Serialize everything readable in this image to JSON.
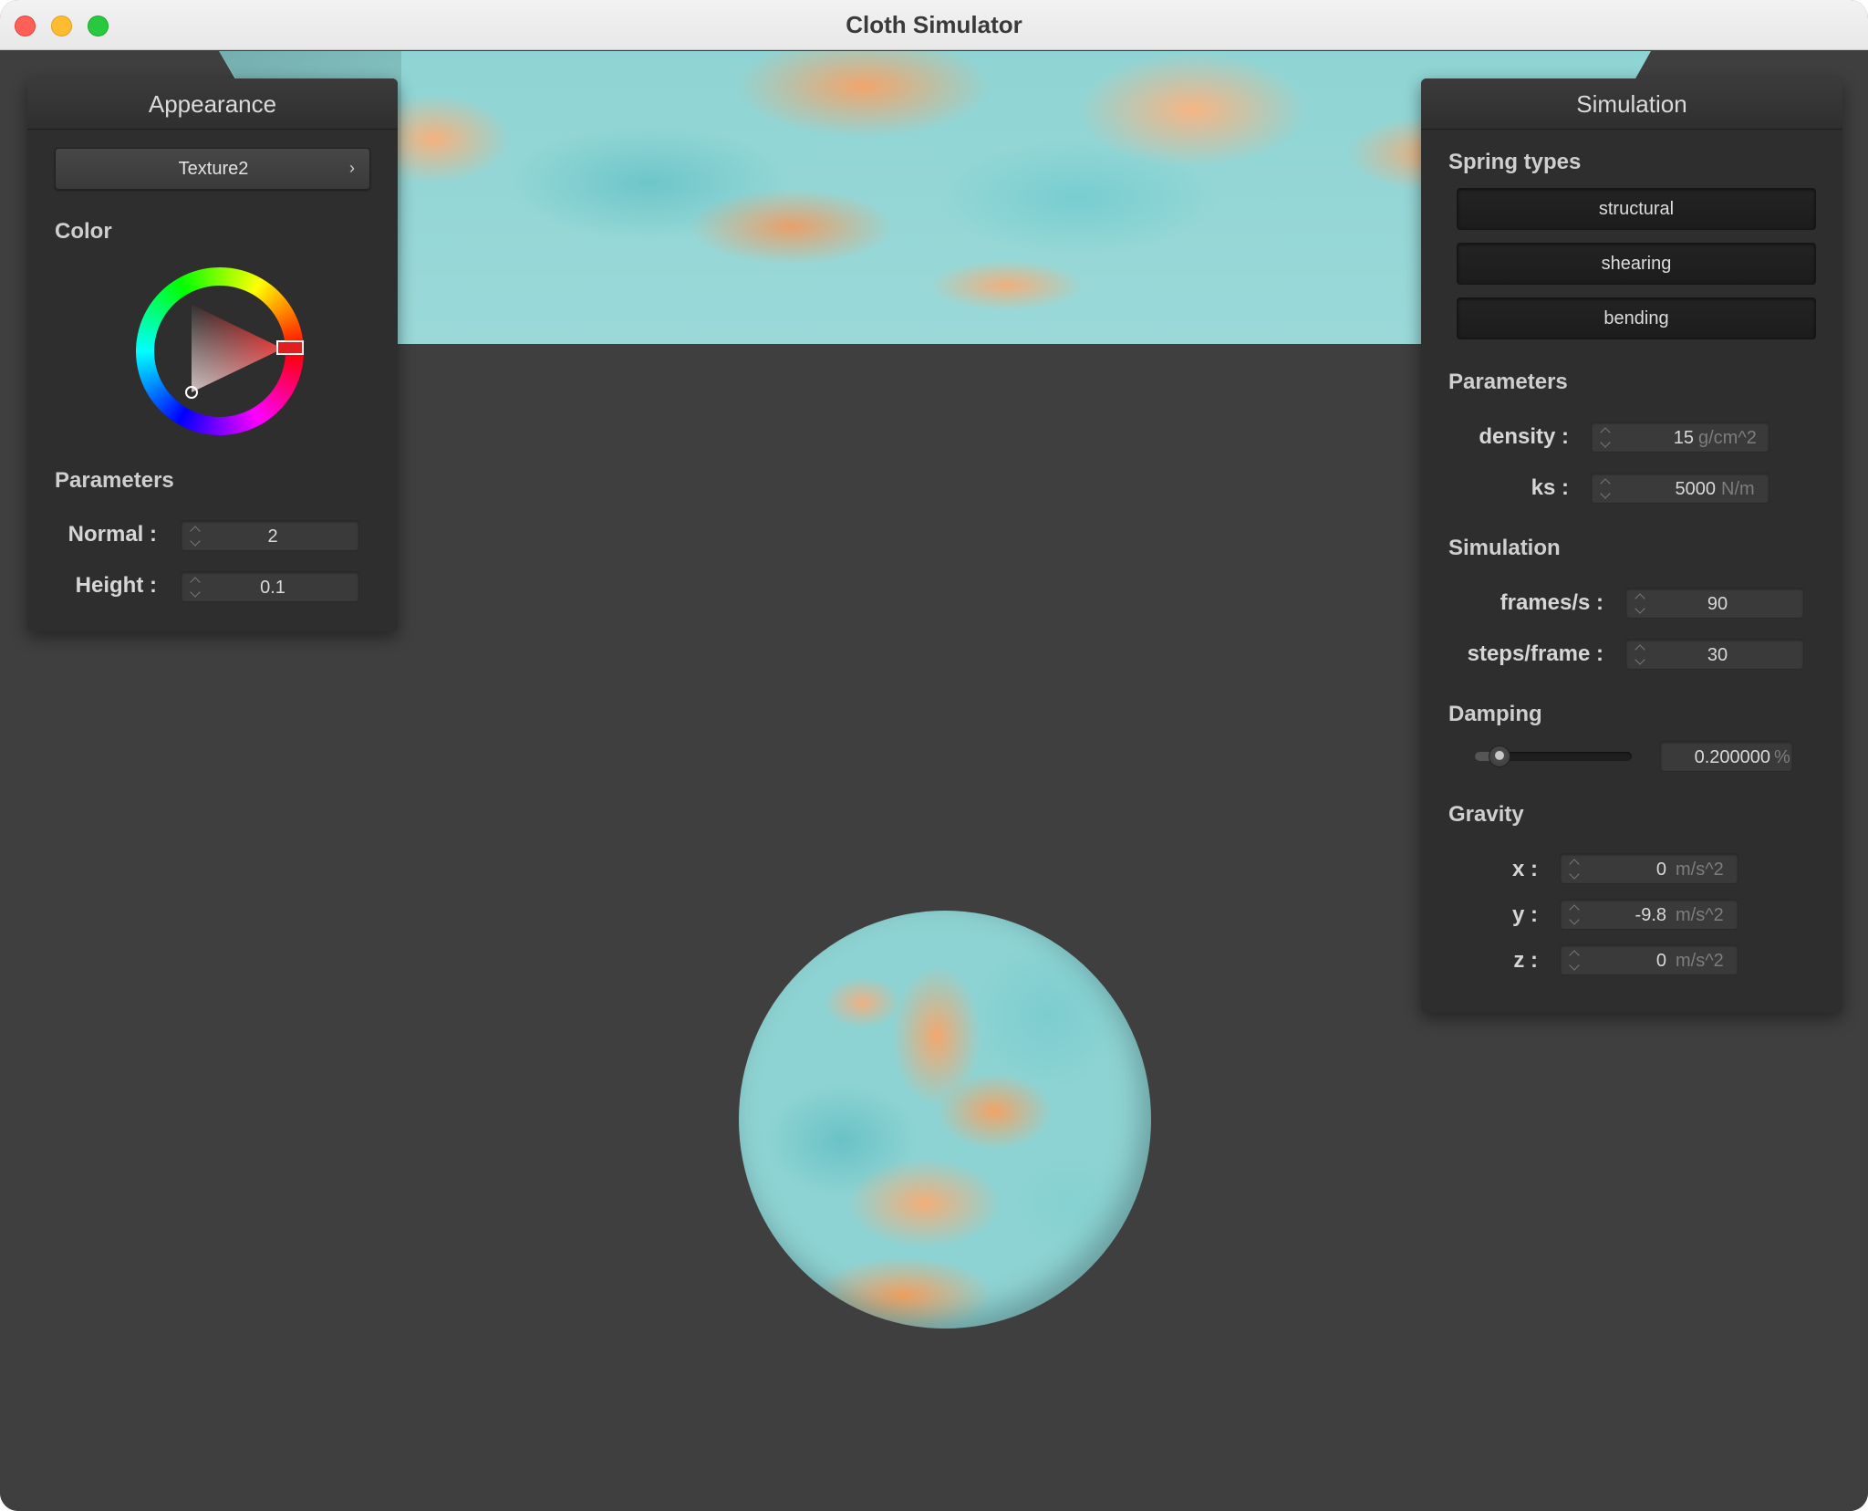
{
  "window": {
    "title": "Cloth Simulator"
  },
  "appearance": {
    "header": "Appearance",
    "texture_selected": "Texture2",
    "chevron": "›",
    "color_label": "Color",
    "color_value": "#e02020",
    "parameters_label": "Parameters",
    "normal_label": "Normal :",
    "normal_value": "2",
    "height_label": "Height :",
    "height_value": "0.1"
  },
  "simulation_panel": {
    "header": "Simulation",
    "spring_types_label": "Spring types",
    "spring_types": [
      "structural",
      "shearing",
      "bending"
    ],
    "parameters_label": "Parameters",
    "density_label": "density :",
    "density_value": "15",
    "density_unit": "g/cm^2",
    "ks_label": "ks :",
    "ks_value": "5000",
    "ks_unit": "N/m",
    "simulation_label": "Simulation",
    "fps_label": "frames/s :",
    "fps_value": "90",
    "steps_label": "steps/frame :",
    "steps_value": "30",
    "damping_label": "Damping",
    "damping_value": "0.200000",
    "damping_unit": "%",
    "damping_fraction": 0.2,
    "gravity_label": "Gravity",
    "gravity": [
      {
        "label": "x :",
        "value": "0",
        "unit": "m/s^2"
      },
      {
        "label": "y :",
        "value": "-9.8",
        "unit": "m/s^2"
      },
      {
        "label": "z :",
        "value": "0",
        "unit": "m/s^2"
      }
    ]
  }
}
